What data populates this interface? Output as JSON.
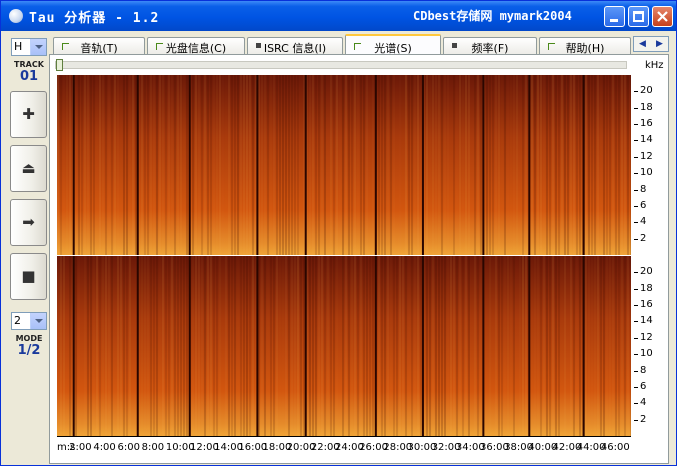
{
  "window": {
    "title": "Tau 分析器 - 1.2",
    "subtitle": "CDbest存储网 mymark2004"
  },
  "left_panel": {
    "top_combo": "H",
    "track_label": "TRACK",
    "track_value": "01",
    "buttons": [
      "add-icon",
      "eject-icon",
      "arrow-right-icon",
      "stop-icon"
    ],
    "mode_combo": "2",
    "mode_label": "MODE",
    "mode_value": "1/2"
  },
  "tabs": [
    {
      "label": "音轨(T)",
      "active": false
    },
    {
      "label": "光盘信息(C)",
      "active": false
    },
    {
      "label": "ISRC 信息(I)",
      "active": false
    },
    {
      "label": "光谱(S)",
      "active": true
    },
    {
      "label": "频率(F)",
      "active": false
    },
    {
      "label": "帮助(H)",
      "active": false
    }
  ],
  "chart_data": {
    "type": "heatmap",
    "title": "",
    "ylabel": "kHz",
    "xlabel": "",
    "channels": 2,
    "y_ticks": [
      2,
      4,
      6,
      8,
      10,
      12,
      14,
      16,
      18,
      20
    ],
    "ylim": [
      0,
      22
    ],
    "x_ticks": [
      "m:s",
      "2:00",
      "4:00",
      "6:00",
      "8:00",
      "10:00",
      "12:00",
      "14:00",
      "16:00",
      "18:00",
      "20:00",
      "22:00",
      "24:00",
      "26:00",
      "28:00",
      "30:00",
      "32:00",
      "34:00",
      "36:00",
      "38:00",
      "40:00",
      "42:00",
      "44:00",
      "46:00"
    ],
    "track_boundaries_min": [
      1.3,
      6.6,
      10.9,
      16.5,
      20.5,
      26.3,
      30.2,
      35.2,
      39.0,
      43.5
    ],
    "colors": {
      "low": "#6a1808",
      "mid": "#d2560f",
      "high": "#f0a437"
    }
  }
}
